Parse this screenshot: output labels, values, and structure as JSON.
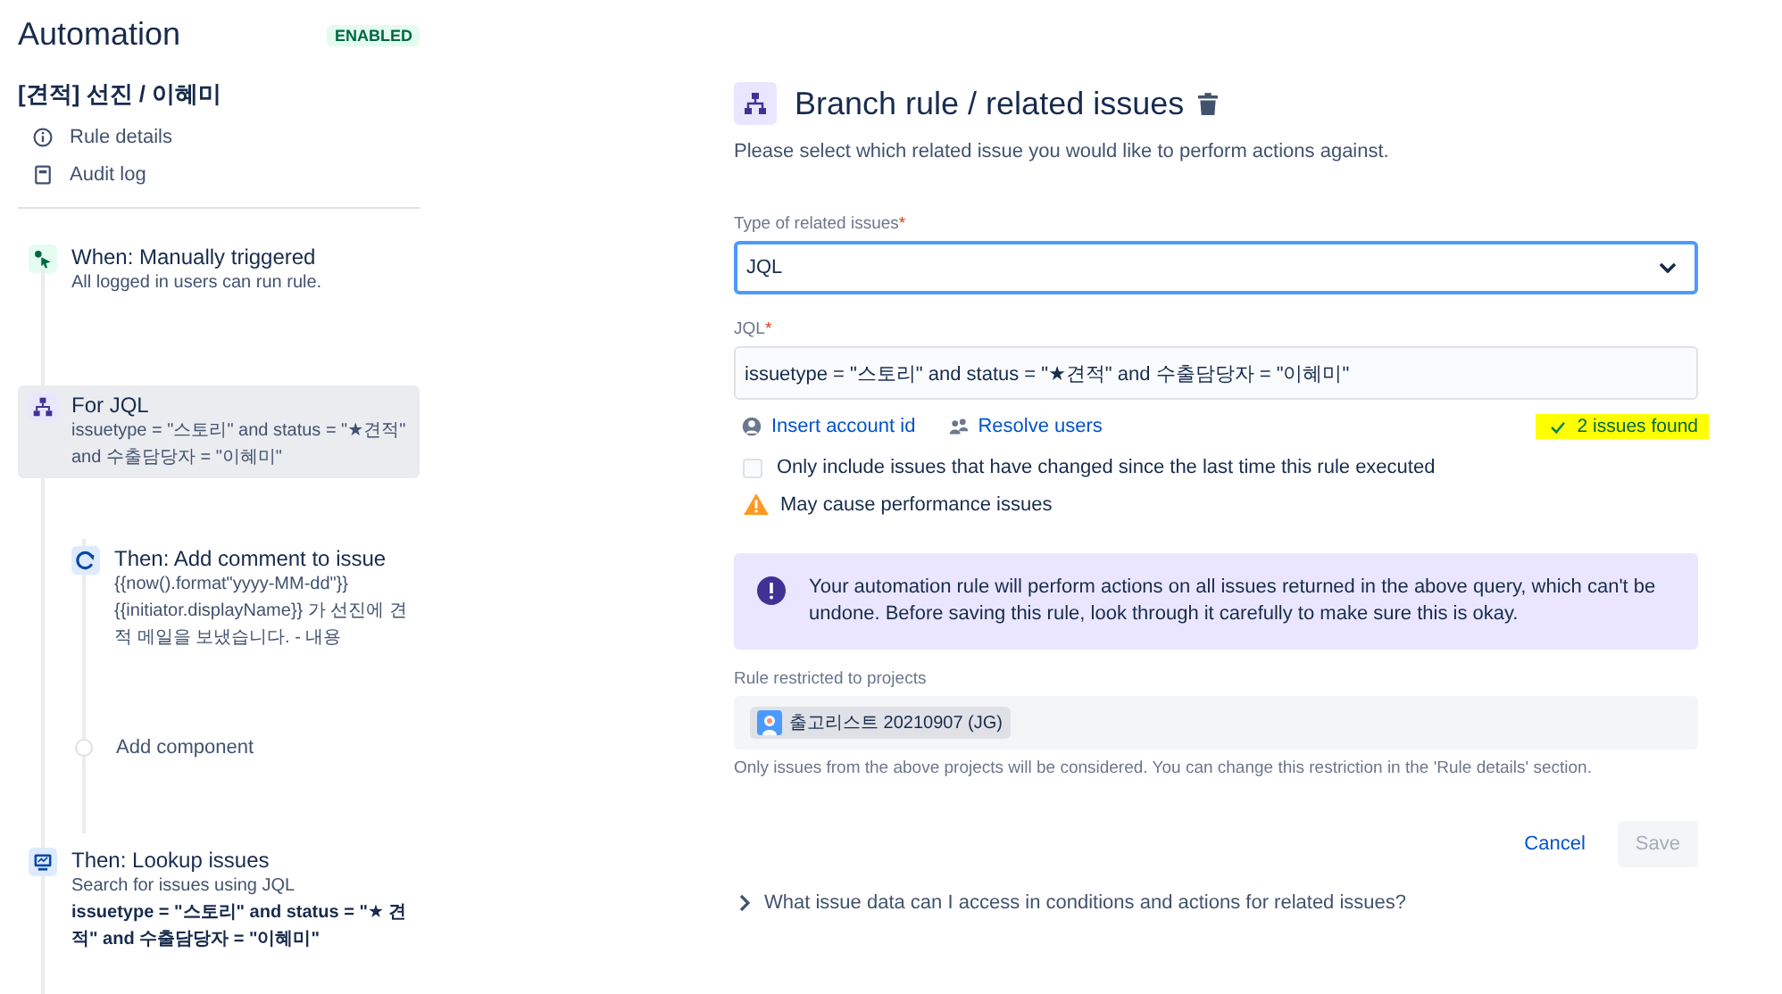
{
  "sidebar": {
    "title": "Automation",
    "badge": "ENABLED",
    "rule_name": "[견적] 선진 / 이혜미",
    "links": [
      {
        "kind": "info",
        "label": "Rule details"
      },
      {
        "kind": "log",
        "label": "Audit log"
      }
    ],
    "components": [
      {
        "kind": "trigger",
        "title": "When: Manually triggered",
        "lines": [
          "All logged in users can run rule."
        ],
        "selected": false
      },
      {
        "kind": "branch",
        "title": "For JQL",
        "lines": [
          "issuetype = \"스토리\" and status = \"★견적\" and 수출담당자 = \"이혜미\""
        ],
        "selected": true,
        "children": [
          {
            "kind": "comment",
            "title": "Then: Add comment to issue",
            "lines": [
              "{{now().format\"yyyy-MM-dd\"}}",
              "{{initiator.displayName}} 가 선진에 견적 메일을 보냈습니다. - 내용"
            ],
            "selected": false
          },
          {
            "kind": "add",
            "title": "Add component"
          }
        ]
      },
      {
        "kind": "lookup",
        "title": "Then: Lookup issues",
        "lines": [
          "Search for issues using JQL",
          "**issuetype = \"스토리\" and status = \"★ 견적\" and 수출담당자 = \"이혜미\"**"
        ],
        "selected": false
      }
    ]
  },
  "panel": {
    "title": "Branch rule / related issues",
    "description": "Please select which related issue you would like to perform actions against.",
    "type_field": {
      "label": "Type of related issues",
      "required_mark": "*",
      "value": "JQL"
    },
    "jql_field": {
      "label": "JQL",
      "required_mark": "*",
      "value": "issuetype = \"스토리\" and status = \"★견적\" and 수출담당자 = \"이혜미\""
    },
    "links": [
      {
        "kind": "account",
        "label": "Insert account id"
      },
      {
        "kind": "users",
        "label": "Resolve users"
      }
    ],
    "result": "2 issues found",
    "checkbox": {
      "label": "Only include issues that have changed since the last time this rule executed",
      "checked": false
    },
    "warning": "May cause performance issues",
    "notice": "Your automation rule will perform actions on all issues returned in the above query, which can't be undone. Before saving this rule, look through it carefully to make sure this is okay.",
    "projects_label": "Rule restricted to projects",
    "projects": [
      {
        "name": "출고리스트 20210907 (JG)"
      }
    ],
    "projects_help": "Only issues from the above projects will be considered. You can change this restriction in the 'Rule details' section.",
    "buttons": [
      {
        "kind": "link",
        "label": "Cancel",
        "disabled": false
      },
      {
        "kind": "primary",
        "label": "Save",
        "disabled": true
      }
    ],
    "expander": {
      "label": "What issue data can I access in conditions and actions for related issues?",
      "expanded": false
    }
  }
}
